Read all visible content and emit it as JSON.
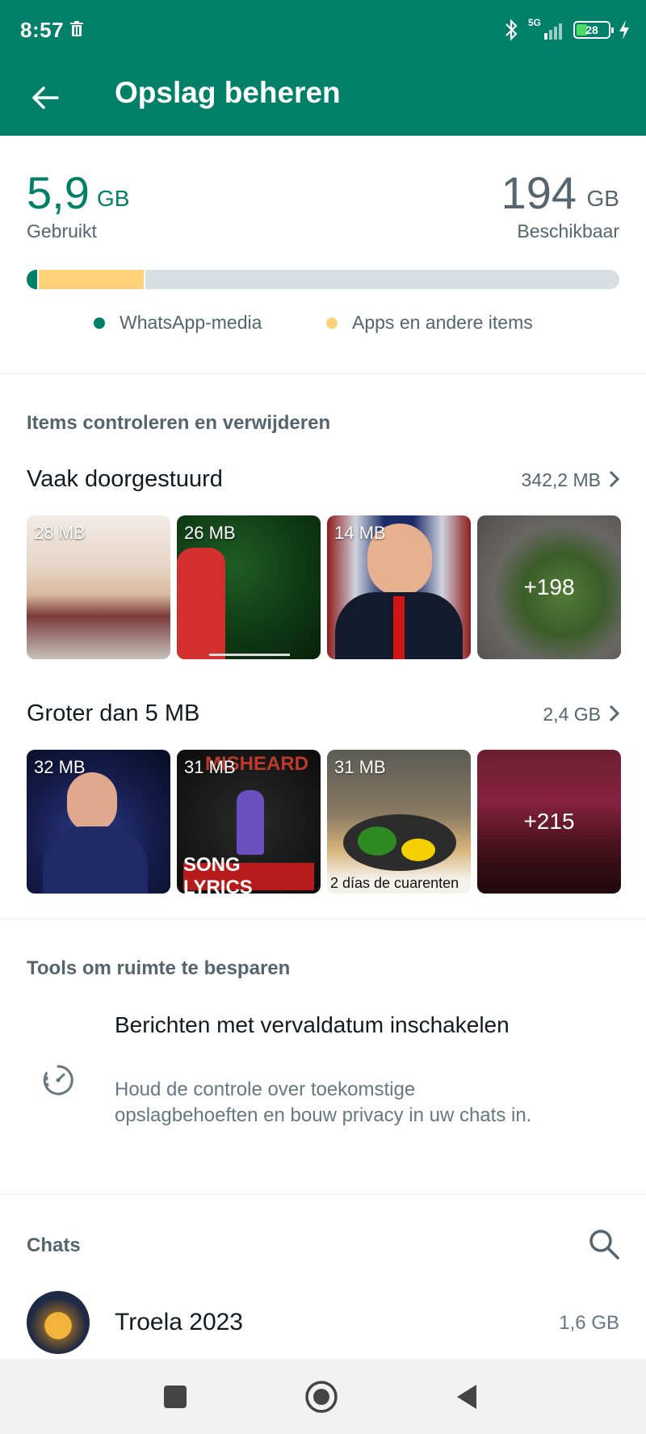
{
  "status": {
    "time": "8:57",
    "network": "5G",
    "battery": "28"
  },
  "appbar": {
    "title": "Opslag beheren"
  },
  "storage": {
    "used_value": "5,9",
    "used_unit": "GB",
    "used_label": "Gebruikt",
    "available_value": "194",
    "available_unit": "GB",
    "available_label": "Beschikbaar",
    "whatsapp_fraction": 0.02,
    "apps_fraction": 0.18,
    "legend": {
      "whatsapp_media": "WhatsApp-media",
      "apps_other": "Apps en andere items"
    },
    "colors": {
      "whatsapp": "#008069",
      "apps": "#ffd279",
      "free": "#d9dee2"
    }
  },
  "review": {
    "heading": "Items controleren en verwijderen",
    "forwarded": {
      "title": "Vaak doorgestuurd",
      "size": "342,2 MB",
      "items": [
        {
          "size": "28 MB"
        },
        {
          "size": "26 MB"
        },
        {
          "size": "14 MB"
        },
        {
          "more": "+198"
        }
      ]
    },
    "large": {
      "title": "Groter dan 5 MB",
      "size": "2,4 GB",
      "items": [
        {
          "size": "32 MB"
        },
        {
          "size": "31 MB",
          "overlay_top": "MISHEARD",
          "overlay_bottom": "SONG LYRICS"
        },
        {
          "size": "31 MB",
          "caption": "2 días de cuarenten"
        },
        {
          "more": "+215"
        }
      ]
    }
  },
  "tools": {
    "heading": "Tools om ruimte te besparen",
    "title": "Berichten met vervaldatum inschakelen",
    "description": "Houd de controle over toekomstige opslagbehoeften en bouw privacy in uw chats in."
  },
  "chats": {
    "heading": "Chats",
    "items": [
      {
        "name": "Troela 2023",
        "size": "1,6 GB"
      }
    ]
  }
}
